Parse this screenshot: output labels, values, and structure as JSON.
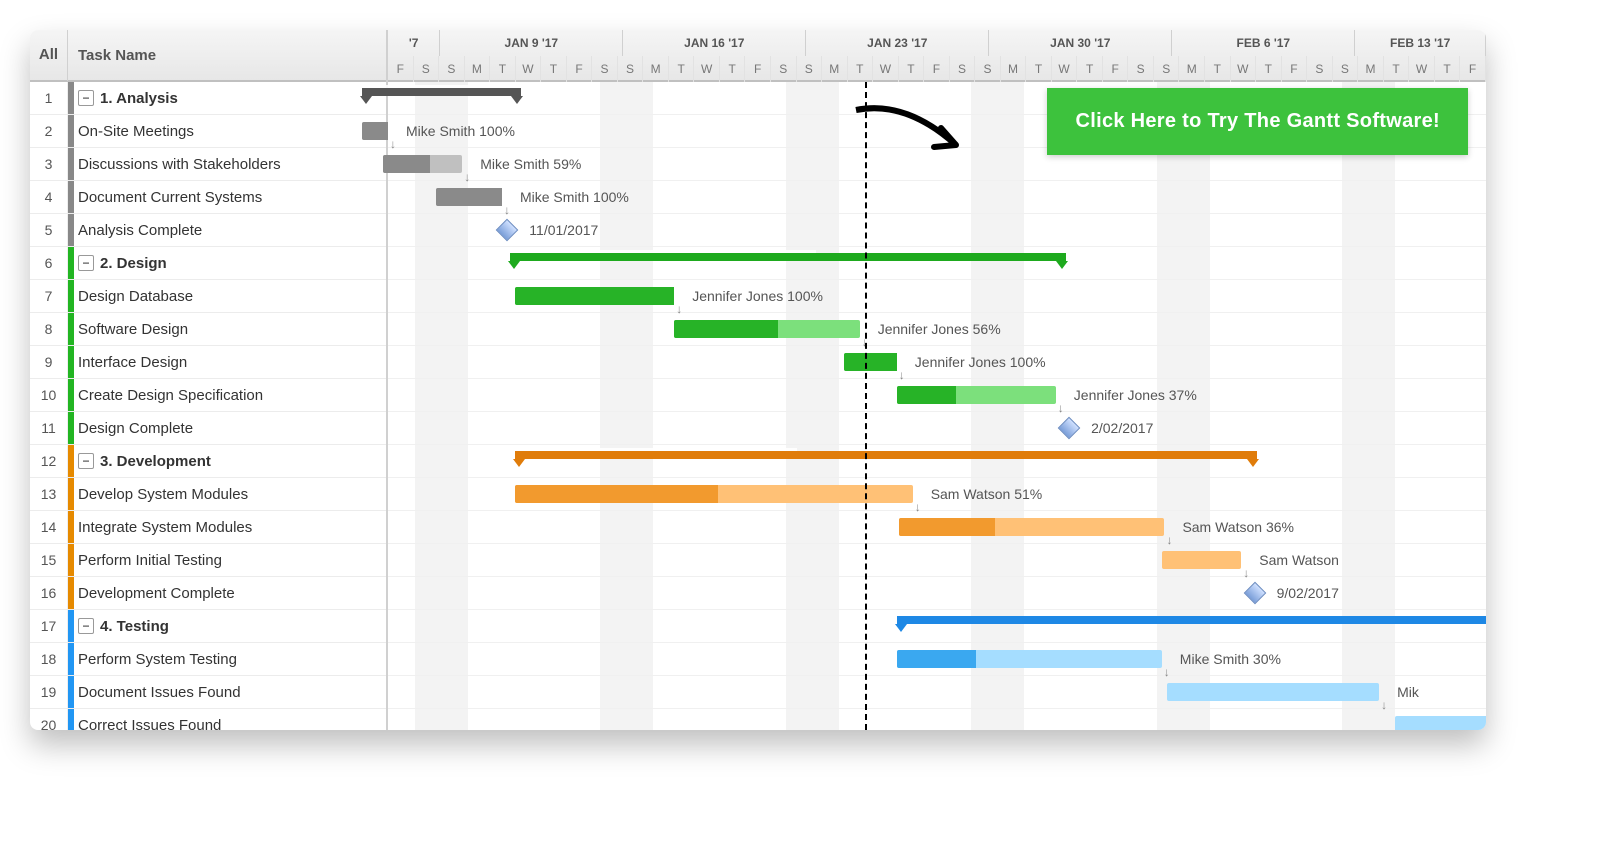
{
  "header": {
    "all": "All",
    "taskName": "Task Name"
  },
  "cta": {
    "label": "Click Here to Try The Gantt Software!"
  },
  "timeline": {
    "dayWidth": 26.5,
    "startOffset": -1,
    "weeks": [
      {
        "label": "'7",
        "days": 2
      },
      {
        "label": "JAN 9 '17",
        "days": 7
      },
      {
        "label": "JAN 16 '17",
        "days": 7
      },
      {
        "label": "JAN 23 '17",
        "days": 7
      },
      {
        "label": "JAN 30 '17",
        "days": 7
      },
      {
        "label": "FEB 6 '17",
        "days": 7
      },
      {
        "label": "FEB 13 '17",
        "days": 5
      }
    ],
    "dayLetters": [
      "F",
      "S",
      "S",
      "M",
      "T",
      "W",
      "T",
      "F",
      "S",
      "S",
      "M",
      "T",
      "W",
      "T",
      "F",
      "S",
      "S",
      "M",
      "T",
      "W",
      "T",
      "F",
      "S",
      "S",
      "M",
      "T",
      "W",
      "T",
      "F",
      "S",
      "S",
      "M",
      "T",
      "W",
      "T",
      "F",
      "S",
      "S",
      "M",
      "T",
      "W",
      "T",
      "F"
    ],
    "weekendIndices": [
      1,
      2,
      8,
      9,
      15,
      16,
      22,
      23,
      29,
      30,
      36,
      37
    ],
    "todayIndex": 18
  },
  "rows": [
    {
      "n": 1,
      "type": "group",
      "stripe": "grey",
      "text": "1. Analysis",
      "bar": {
        "kind": "summary",
        "color": "grey",
        "start": 0,
        "dur": 6,
        "progress": 95
      }
    },
    {
      "n": 2,
      "type": "task",
      "stripe": "grey",
      "text": "On-Site Meetings",
      "bar": {
        "kind": "task",
        "color": "grey",
        "start": 0,
        "dur": 1,
        "progress": 100,
        "label": "Mike Smith  100%"
      }
    },
    {
      "n": 3,
      "type": "task",
      "stripe": "grey",
      "text": "Discussions with Stakeholders",
      "bar": {
        "kind": "task",
        "color": "grey",
        "start": 0.8,
        "dur": 3,
        "progress": 59,
        "label": "Mike Smith  59%"
      }
    },
    {
      "n": 4,
      "type": "task",
      "stripe": "grey",
      "text": "Document Current Systems",
      "bar": {
        "kind": "task",
        "color": "grey",
        "start": 2.8,
        "dur": 2.5,
        "progress": 100,
        "label": "Mike Smith  100%"
      }
    },
    {
      "n": 5,
      "type": "task",
      "stripe": "grey",
      "text": "Analysis Complete",
      "bar": {
        "kind": "milestone",
        "start": 5.2,
        "label": "11/01/2017"
      }
    },
    {
      "n": 6,
      "type": "group",
      "stripe": "green",
      "text": "2. Design",
      "bar": {
        "kind": "summary",
        "color": "green",
        "start": 5.6,
        "dur": 21,
        "progress": 55
      }
    },
    {
      "n": 7,
      "type": "task",
      "stripe": "green",
      "text": "Design Database",
      "bar": {
        "kind": "task",
        "color": "green",
        "start": 5.8,
        "dur": 6,
        "progress": 100,
        "label": "Jennifer Jones  100%"
      }
    },
    {
      "n": 8,
      "type": "task",
      "stripe": "green",
      "text": "Software Design",
      "bar": {
        "kind": "task",
        "color": "green",
        "start": 11.8,
        "dur": 7,
        "progress": 56,
        "label": "Jennifer Jones  56%"
      }
    },
    {
      "n": 9,
      "type": "task",
      "stripe": "green",
      "text": "Interface Design",
      "bar": {
        "kind": "task",
        "color": "green",
        "start": 18.2,
        "dur": 2,
        "progress": 100,
        "label": "Jennifer Jones  100%"
      }
    },
    {
      "n": 10,
      "type": "task",
      "stripe": "green",
      "text": "Create Design Specification",
      "bar": {
        "kind": "task",
        "color": "green",
        "start": 20.2,
        "dur": 6,
        "progress": 37,
        "label": "Jennifer Jones  37%"
      }
    },
    {
      "n": 11,
      "type": "task",
      "stripe": "green",
      "text": "Design Complete",
      "bar": {
        "kind": "milestone",
        "start": 26.4,
        "label": "2/02/2017"
      }
    },
    {
      "n": 12,
      "type": "group",
      "stripe": "orange",
      "text": "3. Development",
      "bar": {
        "kind": "summary",
        "color": "orange",
        "start": 5.8,
        "dur": 28,
        "progress": 38
      }
    },
    {
      "n": 13,
      "type": "task",
      "stripe": "orange",
      "text": "Develop System Modules",
      "bar": {
        "kind": "task",
        "color": "orange",
        "start": 5.8,
        "dur": 15,
        "progress": 51,
        "label": "Sam Watson  51%"
      }
    },
    {
      "n": 14,
      "type": "task",
      "stripe": "orange",
      "text": "Integrate System Modules",
      "bar": {
        "kind": "task",
        "color": "orange",
        "start": 20.3,
        "dur": 10,
        "progress": 36,
        "label": "Sam Watson  36%"
      }
    },
    {
      "n": 15,
      "type": "task",
      "stripe": "orange",
      "text": "Perform Initial Testing",
      "bar": {
        "kind": "task",
        "color": "orange",
        "start": 30.2,
        "dur": 3,
        "progress": 0,
        "label": "Sam Watson"
      }
    },
    {
      "n": 16,
      "type": "task",
      "stripe": "orange",
      "text": "Development Complete",
      "bar": {
        "kind": "milestone",
        "start": 33.4,
        "label": "9/02/2017"
      }
    },
    {
      "n": 17,
      "type": "group",
      "stripe": "blue",
      "text": "4. Testing",
      "bar": {
        "kind": "summary",
        "color": "blue",
        "start": 20.2,
        "dur": 24,
        "progress": 10
      }
    },
    {
      "n": 18,
      "type": "task",
      "stripe": "blue",
      "text": "Perform System Testing",
      "bar": {
        "kind": "task",
        "color": "blue",
        "start": 20.2,
        "dur": 10,
        "progress": 30,
        "label": "Mike Smith  30%"
      }
    },
    {
      "n": 19,
      "type": "task",
      "stripe": "blue",
      "text": "Document Issues Found",
      "bar": {
        "kind": "task",
        "color": "blue",
        "start": 30.4,
        "dur": 8,
        "progress": 0,
        "label": "Mik"
      }
    },
    {
      "n": 20,
      "type": "task",
      "stripe": "blue",
      "text": "Correct Issues Found",
      "bar": {
        "kind": "task",
        "color": "blue",
        "start": 39,
        "dur": 4,
        "progress": 0,
        "label": ""
      }
    }
  ]
}
